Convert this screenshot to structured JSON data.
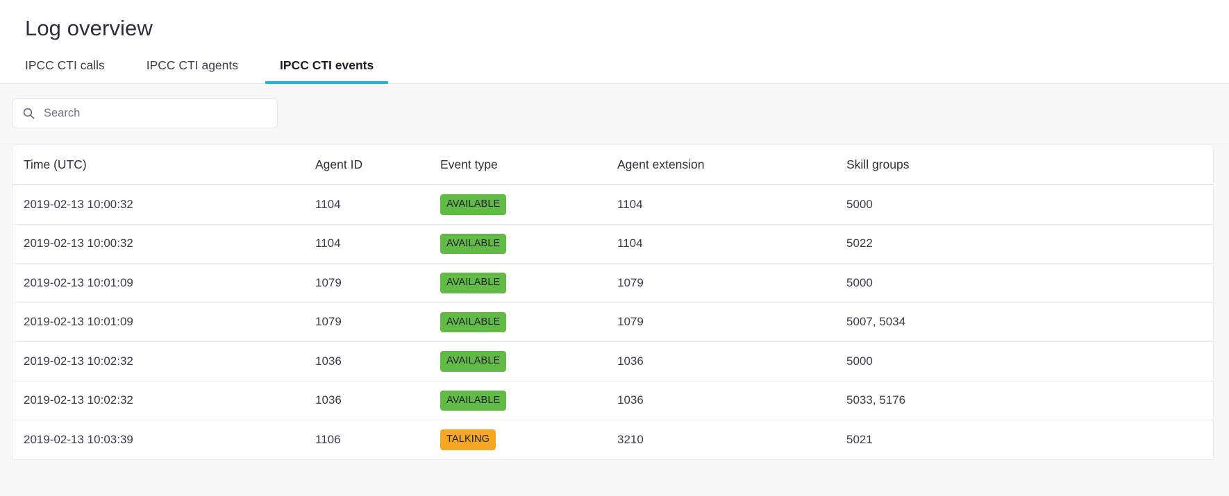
{
  "header": {
    "title": "Log overview"
  },
  "tabs": [
    {
      "label": "IPCC CTI calls",
      "active": false
    },
    {
      "label": "IPCC CTI agents",
      "active": false
    },
    {
      "label": "IPCC CTI events",
      "active": true
    }
  ],
  "search": {
    "icon": "search-icon",
    "value": "",
    "placeholder": "Search"
  },
  "table": {
    "columns": [
      "Time (UTC)",
      "Agent ID",
      "Event type",
      "Agent extension",
      "Skill groups"
    ],
    "rows": [
      {
        "time": "2019-02-13 10:00:32",
        "agent_id": "1104",
        "event_type": "AVAILABLE",
        "event_state": "available",
        "agent_extension": "1104",
        "skill_groups": "5000"
      },
      {
        "time": "2019-02-13 10:00:32",
        "agent_id": "1104",
        "event_type": "AVAILABLE",
        "event_state": "available",
        "agent_extension": "1104",
        "skill_groups": "5022"
      },
      {
        "time": "2019-02-13 10:01:09",
        "agent_id": "1079",
        "event_type": "AVAILABLE",
        "event_state": "available",
        "agent_extension": "1079",
        "skill_groups": "5000"
      },
      {
        "time": "2019-02-13 10:01:09",
        "agent_id": "1079",
        "event_type": "AVAILABLE",
        "event_state": "available",
        "agent_extension": "1079",
        "skill_groups": "5007, 5034"
      },
      {
        "time": "2019-02-13 10:02:32",
        "agent_id": "1036",
        "event_type": "AVAILABLE",
        "event_state": "available",
        "agent_extension": "1036",
        "skill_groups": "5000"
      },
      {
        "time": "2019-02-13 10:02:32",
        "agent_id": "1036",
        "event_type": "AVAILABLE",
        "event_state": "available",
        "agent_extension": "1036",
        "skill_groups": "5033, 5176"
      },
      {
        "time": "2019-02-13 10:03:39",
        "agent_id": "1106",
        "event_type": "TALKING",
        "event_state": "talking",
        "agent_extension": "3210",
        "skill_groups": "5021"
      }
    ]
  },
  "colors": {
    "accent": "#1fb6e0",
    "badge_available": "#62bb46",
    "badge_talking": "#f5a623",
    "page_background": "#f7f7f8",
    "card_background": "#ffffff",
    "text": "#2e3039"
  }
}
